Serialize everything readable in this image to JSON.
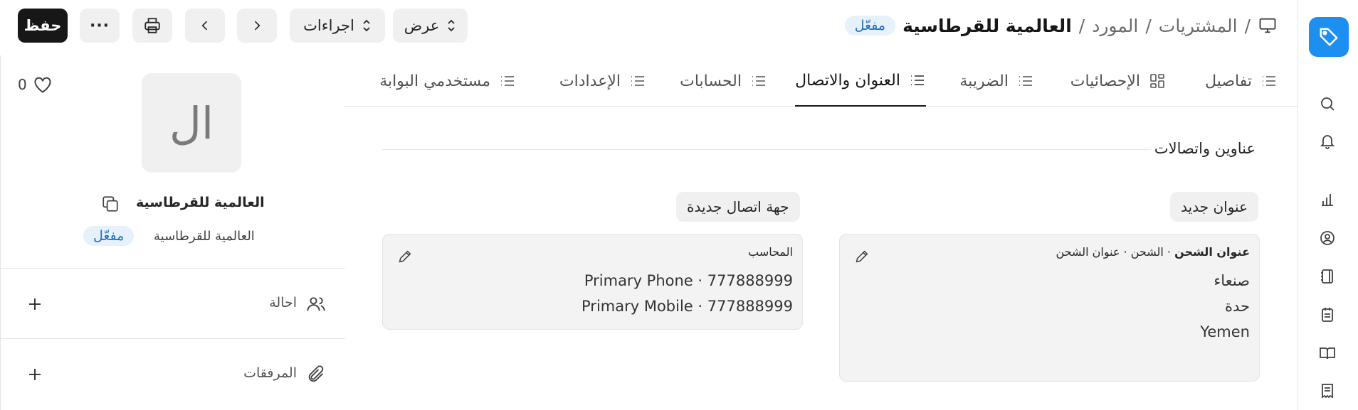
{
  "header": {
    "breadcrumb": [
      "المشتريات",
      "المورد"
    ],
    "separator": "/",
    "current": "العالمية للقرطاسية",
    "status": "مفعّل",
    "view_label": "عرض",
    "actions_label": "اجراءات",
    "save_label": "حفظ",
    "more_label": "···"
  },
  "tabs": [
    "تفاصيل",
    "الإحصائيات",
    "الضريبة",
    "العنوان والاتصال",
    "الحسابات",
    "الإعدادات",
    "مستخدمي البوابة"
  ],
  "sidebar_left": {
    "avatar_initials": "ال",
    "likes_count": "0",
    "name": "العالمية للقرطاسية",
    "subtitle": "العالمية للقرطاسية",
    "status": "مفعّل",
    "assign_label": "احالة",
    "attachments_label": "المرفقات"
  },
  "section": {
    "title": "عناوين واتصالات",
    "new_address": "عنوان جديد",
    "new_contact": "جهة اتصال جديدة"
  },
  "address_card": {
    "title_bold": "عنوان الشحن",
    "title_meta": " · الشحن · عنوان الشحن",
    "lines": [
      "صنعاء",
      "حدة",
      "Yemen"
    ]
  },
  "contact_card": {
    "title": "المحاسب",
    "phone": "Primary Phone · 777888999",
    "mobile": "Primary Mobile · 777888999"
  },
  "icons": {
    "rail": [
      "tag-logo-icon",
      "search-icon",
      "bell-icon",
      "bar-chart-icon",
      "user-circle-icon",
      "notebook-icon",
      "clipboard-icon",
      "book-open-icon",
      "receipt-icon"
    ]
  },
  "colors": {
    "accent": "#1c8ff0",
    "badge_bg": "#e6f1fb",
    "badge_text": "#1f6fbf"
  }
}
